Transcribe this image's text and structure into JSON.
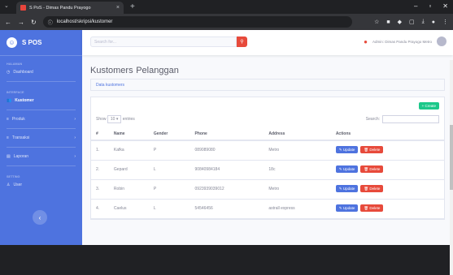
{
  "browser": {
    "tab_title": "S PoS - Dimas Pandu Prayogo",
    "url": "localhost/skripsi/kustomer"
  },
  "sidebar": {
    "brand": "S POS",
    "heading_main": "HALAMAN",
    "dashboard": "Dashboard",
    "heading_interface": "INTERFACE",
    "kustomer": "Kustomer",
    "produk": "Produk",
    "transaksi": "Transaksi",
    "laporan": "Laporan",
    "heading_setting": "SETTING",
    "user": "User"
  },
  "topbar": {
    "search_placeholder": "Search for...",
    "user_label": "Admin: Dimas Pandu Prayogo Metro"
  },
  "page": {
    "title": "Kustomers",
    "subtitle": "Pelanggan",
    "card_header": "Data kustomers",
    "create_label": "+ Create",
    "show_label": "Show",
    "entries_value": "10",
    "entries_label": "entries",
    "search_label": "Search:"
  },
  "table": {
    "headers": [
      "#",
      "Name",
      "Gender",
      "Phone",
      "Address",
      "Actions"
    ],
    "rows": [
      {
        "no": "1.",
        "name": "Kafka",
        "gender": "P",
        "phone": "089089080",
        "address": "Metro"
      },
      {
        "no": "2.",
        "name": "Gepard",
        "gender": "L",
        "phone": "90840984184",
        "address": "18c"
      },
      {
        "no": "3.",
        "name": "Robin",
        "gender": "P",
        "phone": "0923939039012",
        "address": "Metro"
      },
      {
        "no": "4.",
        "name": "Caelus",
        "gender": "L",
        "phone": "54546456",
        "address": "astrall express"
      }
    ],
    "update_label": "Update",
    "delete_label": "Delete"
  }
}
